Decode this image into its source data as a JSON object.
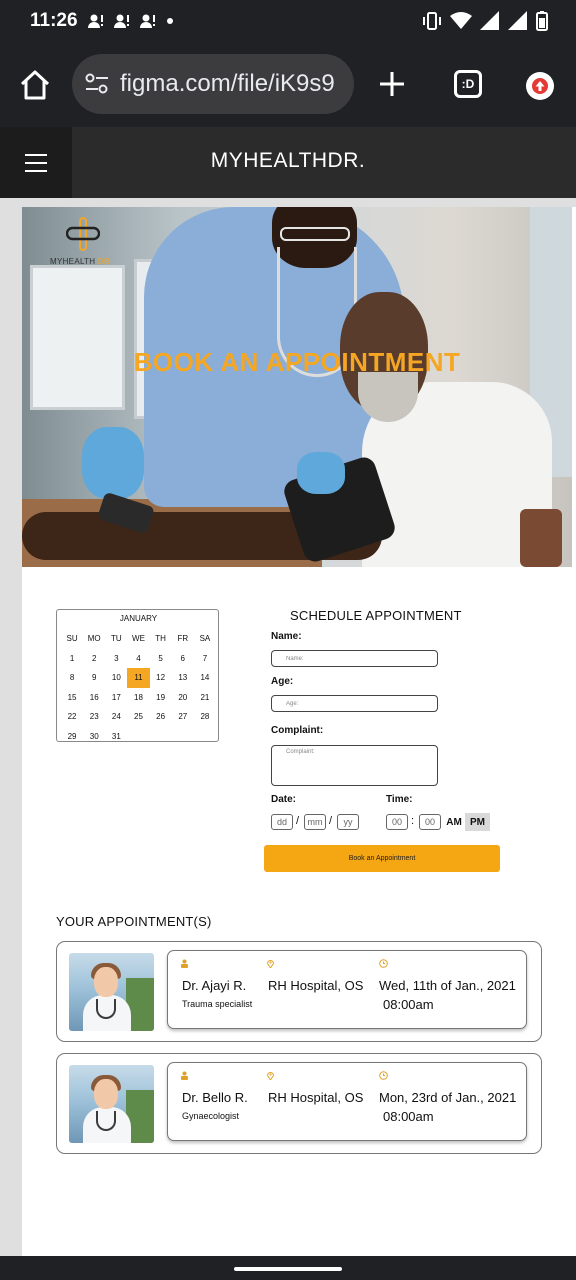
{
  "status_bar": {
    "time": "11:26",
    "left_icons": [
      "person-alert-icon",
      "person-alert-icon",
      "person-alert-icon",
      "dot-icon"
    ],
    "right_icons": [
      "vibrate-icon",
      "wifi-icon",
      "signal-icon",
      "signal-icon",
      "battery-icon"
    ]
  },
  "browser": {
    "url": "figma.com/file/iK9s9",
    "tab_count_label": ":D"
  },
  "site": {
    "title": "MYHEALTHDR.",
    "logo_text": "MYHEALTH",
    "logo_accent": "DR"
  },
  "hero": {
    "title": "BOOK AN APPOINTMENT"
  },
  "calendar": {
    "month": "JANUARY",
    "weekdays": [
      "SU",
      "MO",
      "TU",
      "WE",
      "TH",
      "FR",
      "SA"
    ],
    "days": [
      "1",
      "2",
      "3",
      "4",
      "5",
      "6",
      "7",
      "8",
      "9",
      "10",
      "11",
      "12",
      "13",
      "14",
      "15",
      "16",
      "17",
      "18",
      "19",
      "20",
      "21",
      "22",
      "23",
      "24",
      "25",
      "26",
      "27",
      "28",
      "29",
      "30",
      "31"
    ],
    "selected_day": "11"
  },
  "form": {
    "title": "SCHEDULE APPOINTMENT",
    "name_label": "Name:",
    "name_placeholder": "Name:",
    "age_label": "Age:",
    "age_placeholder": "Age:",
    "complaint_label": "Complaint:",
    "complaint_placeholder": "Complaint:",
    "date_label": "Date:",
    "date_dd": "dd",
    "date_mm": "mm",
    "date_yy": "yy",
    "date_sep": "/",
    "time_label": "Time:",
    "time_hh": "00",
    "time_mm": "00",
    "time_sep": ":",
    "am_label": "AM",
    "pm_label": "PM",
    "submit_label": "Book an Appointment"
  },
  "appointments": {
    "heading": "YOUR APPOINTMENT(S)",
    "items": [
      {
        "doctor": "Dr. Ajayi R.",
        "specialty": "Trauma specialist",
        "hospital": "RH Hospital, OS",
        "date": "Wed, 11th of Jan., 2021",
        "time": "08:00am"
      },
      {
        "doctor": "Dr. Bello R.",
        "specialty": "Gynaecologist",
        "hospital": "RH Hospital, OS",
        "date": "Mon, 23rd of Jan., 2021",
        "time": "08:00am"
      }
    ]
  },
  "colors": {
    "accent": "#f5a623",
    "header_bg": "#2b2b2b",
    "browser_bg": "#202124"
  }
}
